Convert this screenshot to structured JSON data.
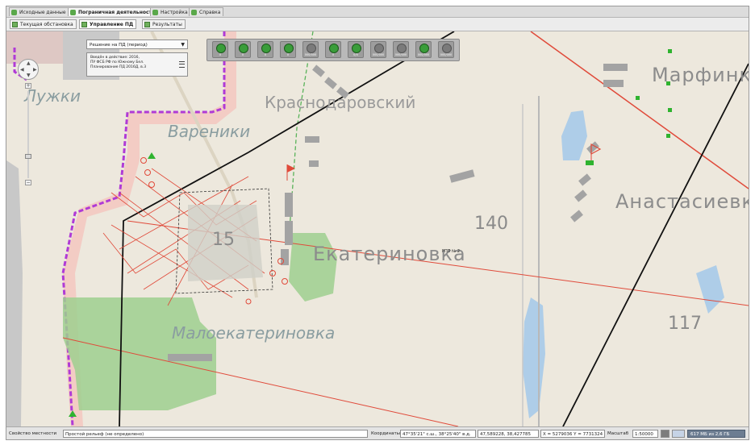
{
  "tabs": [
    {
      "label": "Исходные данные",
      "active": false
    },
    {
      "label": "Пограничная деятельность",
      "active": true
    },
    {
      "label": "Настройка",
      "active": false
    },
    {
      "label": "Справка",
      "active": false
    }
  ],
  "subtabs": [
    {
      "label": "Текущая обстановка",
      "active": false
    },
    {
      "label": "Управление ПД",
      "active": true
    },
    {
      "label": "Результаты",
      "active": false
    }
  ],
  "map": {
    "decision_select": "Решение на ПД (период)",
    "info_lines": [
      "Введён в действие: 2016,",
      "ПУ ФСБ РФ по Южному Бел.",
      "Планирование ПД 2016Д, в.3"
    ],
    "toolbar_buttons": [
      {
        "label": "0",
        "icon": "green"
      },
      {
        "label": "0",
        "icon": "green"
      },
      {
        "label": "0",
        "icon": "green"
      },
      {
        "label": "0",
        "icon": "green"
      },
      {
        "label": "000/000",
        "icon": "grey"
      },
      {
        "label": "0",
        "icon": "green"
      },
      {
        "label": "0/0",
        "icon": "green"
      },
      {
        "label": "000/000",
        "icon": "grey"
      },
      {
        "label": "000/000",
        "icon": "grey"
      },
      {
        "label": "000/000",
        "icon": "green"
      },
      {
        "label": "000/000",
        "icon": "grey"
      }
    ],
    "place_labels": {
      "luzhki": "Лужки",
      "krasnodarovsky": "Краснодаровский",
      "vareniki": "Вареники",
      "ekaterinovka": "Екатериновка",
      "malоekaterinovka": "Малоекатериновка",
      "marfinka": "Марфинка",
      "anastasievka": "Анастасиевка"
    },
    "grid_numbers": {
      "n140": "140",
      "n117": "117",
      "n15": "15"
    },
    "rpp_label": "РПП № 2"
  },
  "statusbar": {
    "terrain_label": "Свойство местности",
    "terrain_value": "Простой рельеф (не определено)",
    "coords_label": "Координаты",
    "coords_deg": "47°35'21\" с.ш., 38°25'40\" в.д.",
    "coords_dec": "47,589228, 38,427785",
    "coords_xy": "X = 5279036 Y = 7731324",
    "scale_label": "Масштаб",
    "scale_value": "1:50000",
    "memory": "617 МБ из 2,6 ГБ"
  },
  "colors": {
    "map_bg": "#ede8dd",
    "border_purple": "#b03ad6",
    "zone_red": "#e04a3a",
    "forest_green": "#9ecf8f",
    "water_blue": "#aecde8"
  }
}
